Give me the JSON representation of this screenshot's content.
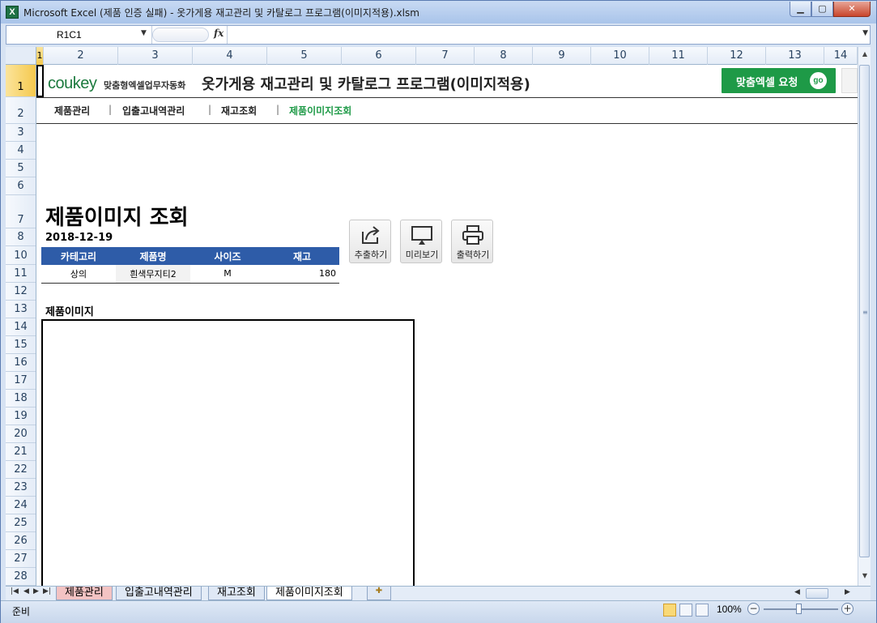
{
  "window": {
    "title": "Microsoft Excel (제품 인증 실패) - 옷가게용 재고관리 및 카탈로그 프로그램(이미지적용).xlsm"
  },
  "formula_bar": {
    "name_box": "R1C1",
    "fx": "fx",
    "value": ""
  },
  "columns": [
    "1",
    "2",
    "3",
    "4",
    "5",
    "6",
    "7",
    "8",
    "9",
    "10",
    "11",
    "12",
    "13",
    "14"
  ],
  "rows": [
    "1",
    "2",
    "3",
    "4",
    "5",
    "6",
    "7",
    "8",
    "10",
    "11",
    "12",
    "13",
    "14",
    "15",
    "16",
    "17",
    "18",
    "19",
    "20",
    "21",
    "22",
    "23",
    "24",
    "25",
    "26",
    "27",
    "28"
  ],
  "header": {
    "logo": "coukey",
    "logo_sub": "맞춤형엑셀업무자동화",
    "title": "옷가게용 재고관리 및 카탈로그 프로그램(이미지적용)",
    "request_button": "맞춤엑셀 요청",
    "go_badge": "go"
  },
  "nav": {
    "items": [
      "제품관리",
      "입출고내역관리",
      "재고조회",
      "제품이미지조회"
    ],
    "separator": "|",
    "active_index": 3
  },
  "main": {
    "title": "제품이미지 조회",
    "date": "2018-12-19",
    "actions": [
      {
        "label": "추출하기",
        "icon": "export-icon"
      },
      {
        "label": "미리보기",
        "icon": "preview-monitor-icon"
      },
      {
        "label": "출력하기",
        "icon": "printer-icon"
      }
    ],
    "table": {
      "headers": [
        "카테고리",
        "제품명",
        "사이즈",
        "재고"
      ],
      "row": [
        "상의",
        "흰색무지티2",
        "M",
        "180"
      ]
    },
    "image_label": "제품이미지"
  },
  "sheet_tabs": [
    "제품관리",
    "입출고내역관리",
    "재고조회",
    "제품이미지조회"
  ],
  "active_sheet_index": 3,
  "status": {
    "text": "준비",
    "zoom": "100%"
  },
  "colors": {
    "accent_green": "#1e9a47",
    "table_header_blue": "#2e5ca8"
  }
}
